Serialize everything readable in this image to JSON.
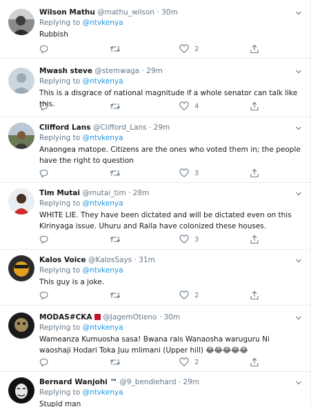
{
  "reply_prefix": "Replying to",
  "tweets": [
    {
      "name": "Wilson Mathu",
      "handle": "@mathu_wilson",
      "sep": "·",
      "time": "30m",
      "replying_to": "@ntvkenya",
      "text": "Rubbish",
      "likes": "2"
    },
    {
      "name": "Mwash steve",
      "handle": "@stemwaga",
      "sep": "·",
      "time": "29m",
      "replying_to": "@ntvkenya",
      "text": "This is a disgrace of national magnitude if a whole senator can talk like this.",
      "likes": "4"
    },
    {
      "name": "Clifford Lans",
      "handle": "@Clifford_Lans",
      "sep": "·",
      "time": "29m",
      "replying_to": "@ntvkenya",
      "text": "Anaongea matope. Citizens are the ones who voted them in; the people have the right to question",
      "likes": "3"
    },
    {
      "name": "Tim Mutai",
      "handle": "@mutai_tim",
      "sep": "·",
      "time": "28m",
      "replying_to": "@ntvkenya",
      "text": "WHITE LIE. They have been dictated and will be dictated even on this Kirinyaga issue. Uhuru and Raila have colonized these houses.",
      "likes": "3"
    },
    {
      "name": "Kalos Voice",
      "handle": "@KalosSays",
      "sep": "·",
      "time": "31m",
      "replying_to": "@ntvkenya",
      "text": "This guy is a joke.",
      "likes": "2"
    },
    {
      "name": "MODAS#CKA",
      "handle": "@JagemOtieno",
      "sep": "·",
      "time": "30m",
      "replying_to": "@ntvkenya",
      "text": "Wameanza Kumuosha sasa! Bwana rais Wanaosha waruguru Ni waoshaji Hodari Toka Juu mlimani (Upper hill) 😂😂😂😂😂",
      "likes": "2"
    },
    {
      "name": "Bernard Wanjohi ™",
      "handle": "@9_bendiehard",
      "sep": "·",
      "time": "29m",
      "replying_to": "@ntvkenya",
      "text": "Stupid man"
    }
  ],
  "icons": {
    "reply": "reply-icon",
    "retweet": "retweet-icon",
    "like": "heart-icon",
    "share": "share-icon",
    "more": "chevron-down-icon"
  },
  "colors": {
    "link": "#1b95e0",
    "muted": "#657786",
    "divider": "#e6ecf0",
    "name": "#14171a"
  }
}
